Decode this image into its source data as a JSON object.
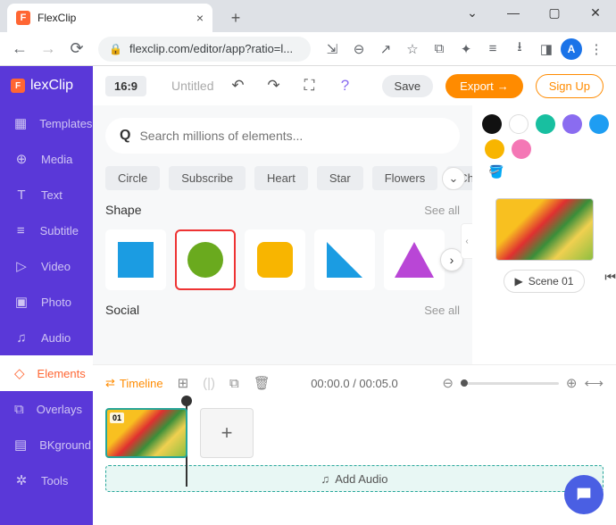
{
  "browser": {
    "tab_title": "FlexClip",
    "url": "flexclip.com/editor/app?ratio=l...",
    "avatar_initial": "A"
  },
  "sidebar": {
    "logo": "lexClip",
    "items": [
      {
        "icon": "▦",
        "label": "Templates"
      },
      {
        "icon": "⊕",
        "label": "Media"
      },
      {
        "icon": "T",
        "label": "Text"
      },
      {
        "icon": "≡",
        "label": "Subtitle"
      },
      {
        "icon": "▷",
        "label": "Video"
      },
      {
        "icon": "▣",
        "label": "Photo"
      },
      {
        "icon": "♫",
        "label": "Audio"
      },
      {
        "icon": "◇",
        "label": "Elements"
      },
      {
        "icon": "⧉",
        "label": "Overlays"
      },
      {
        "icon": "▤",
        "label": "BKground"
      },
      {
        "icon": "✲",
        "label": "Tools"
      }
    ],
    "active_index": 7
  },
  "topbar": {
    "ratio": "16:9",
    "doc_name": "Untitled",
    "save": "Save",
    "export": "Export",
    "signup": "Sign Up"
  },
  "elements_panel": {
    "search_placeholder": "Search millions of elements...",
    "chips": [
      "Circle",
      "Subscribe",
      "Heart",
      "Star",
      "Flowers",
      "Check"
    ],
    "shape_title": "Shape",
    "see_all": "See all",
    "social_title": "Social"
  },
  "colors": {
    "row1": [
      "#111",
      "#fff",
      "#18bfa0",
      "#8a6cf0",
      "#1e9df2"
    ],
    "row2": [
      "#f8b500",
      "#f477b5"
    ]
  },
  "scene": {
    "label": "Scene 01"
  },
  "timeline": {
    "label": "Timeline",
    "time": "00:00.0 / 00:05.0",
    "clip_num": "01",
    "add_audio": "Add Audio"
  }
}
